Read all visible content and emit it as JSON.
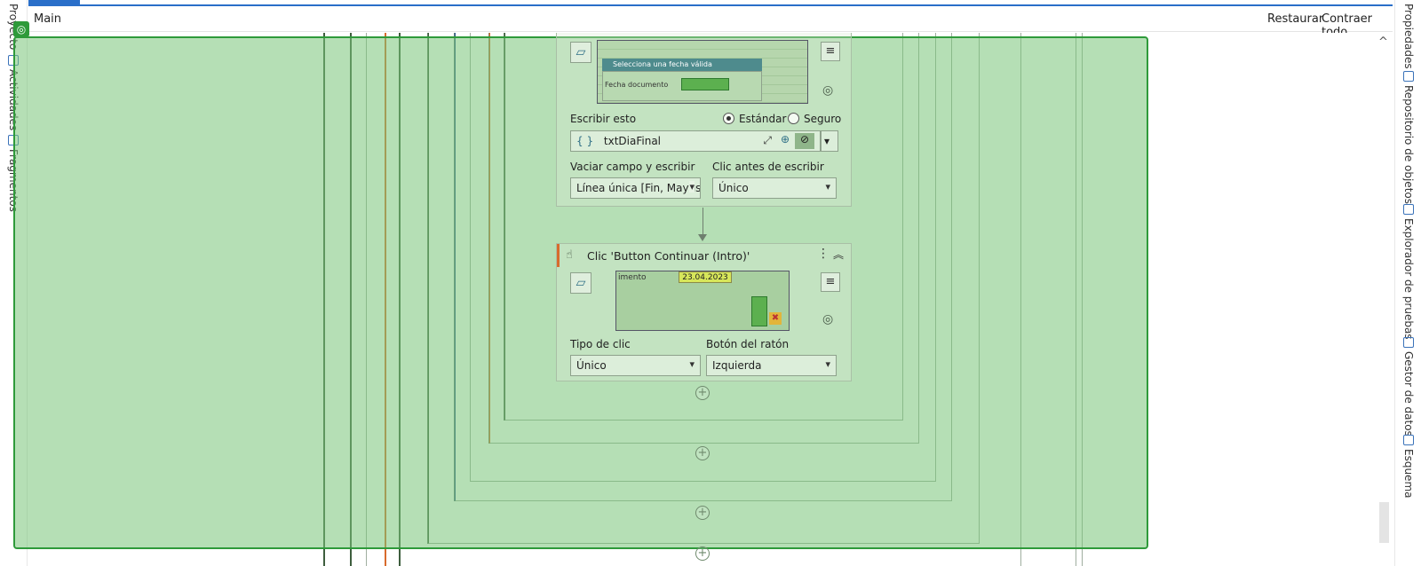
{
  "header": {
    "title": "Main",
    "restore_label": "Restaurar",
    "collapse_label": "Contraer todo"
  },
  "left_tabs": [
    "Proyecto",
    "Actividades",
    "Fragmentos"
  ],
  "right_tabs": [
    "Propiedades",
    "Repositorio de objetos",
    "Explorador de pruebas",
    "Gestor de datos",
    "Esquema"
  ],
  "card1": {
    "write_label": "Escribir esto",
    "mode_standard": "Estándar",
    "mode_secure": "Seguro",
    "variable_value": "txtDiaFinal",
    "braces_icon": "{ }",
    "empty_write_label": "Vaciar campo y escribir",
    "empty_write_value": "Línea única [Fin, Mayús+",
    "click_before_label": "Clic antes de escribir",
    "click_before_value": "Único",
    "thumb_dialog_title": "Selecciona una fecha válida",
    "thumb_field_label": "Fecha documento"
  },
  "card2": {
    "title": "Clic 'Button Continuar (Intro)'",
    "click_type_label": "Tipo de clic",
    "click_type_value": "Único",
    "mouse_button_label": "Botón del ratón",
    "mouse_button_value": "Izquierda",
    "thumb_label": "imento",
    "thumb_date": "23.04.2023"
  },
  "colors": {
    "accent_blue": "#2a6fc9",
    "overlay_green": "#2e9a3a",
    "activity_accent": "#d86b2d"
  },
  "icons": [
    "target-icon",
    "activity-icon",
    "hamburger-icon",
    "braces-icon",
    "expand-icon",
    "add-icon",
    "eye-slash-icon",
    "chevron-down-icon",
    "ellipsis-icon",
    "chevron-up-double-icon",
    "plus-circle-icon",
    "click-icon"
  ]
}
